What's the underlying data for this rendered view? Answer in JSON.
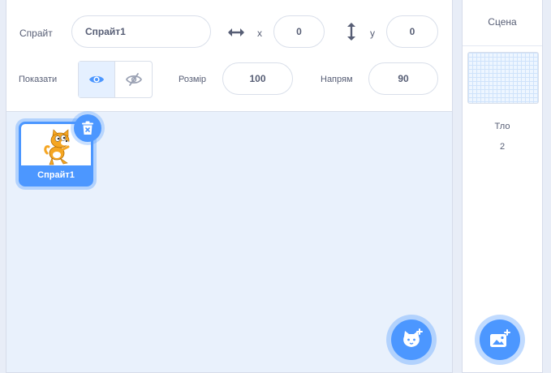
{
  "sprite_info": {
    "sprite_label": "Спрайт",
    "sprite_name": "Спрайт1",
    "x_label": "x",
    "x_value": "0",
    "y_label": "y",
    "y_value": "0",
    "show_label": "Показати",
    "size_label": "Розмір",
    "size_value": "100",
    "direction_label": "Напрям",
    "direction_value": "90",
    "visible": true
  },
  "sprites": [
    {
      "name": "Спрайт1",
      "selected": true
    }
  ],
  "stage": {
    "title": "Сцена",
    "backdrops_label": "Тло",
    "backdrops_count": "2"
  },
  "icons": {
    "x_arrow": "horizontal-arrows-icon",
    "y_arrow": "vertical-arrows-icon",
    "show": "eye-icon",
    "hide": "eye-crossed-icon",
    "delete": "trash-icon",
    "add_sprite": "add-sprite-icon",
    "add_backdrop": "add-backdrop-icon"
  },
  "colors": {
    "accent": "#4c97ff",
    "pane_bg": "#e9f1fc",
    "text": "#575e75"
  }
}
